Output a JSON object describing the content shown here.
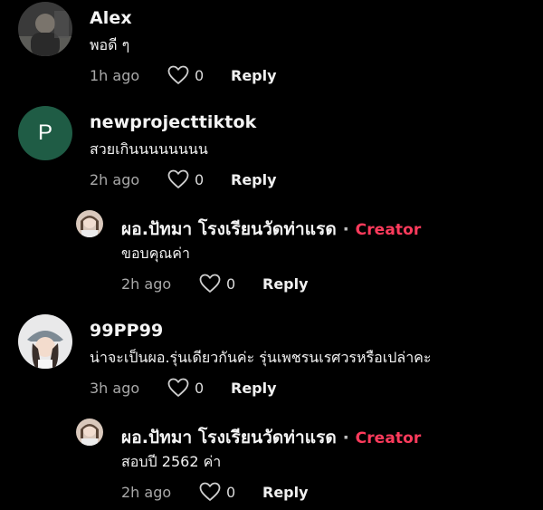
{
  "colors": {
    "background": "#000000",
    "creator_badge": "#ff3b5c",
    "muted_text": "#a9a9a9",
    "avatar_p_bg": "#1f5c45"
  },
  "comments": [
    {
      "username": "Alex",
      "text": "พอดี ๆ",
      "time": "1h ago",
      "likes": "0",
      "reply_label": "Reply",
      "avatar_icon": "user-photo-avatar"
    },
    {
      "username": "newprojecttiktok",
      "text": "สวยเกินนนนนนนน",
      "time": "2h ago",
      "likes": "0",
      "reply_label": "Reply",
      "avatar_letter": "P"
    },
    {
      "username": "ผอ.ปัทมา โรงเรียนวัดท่าแรด",
      "separator": "·",
      "badge": "Creator",
      "text": "ขอบคุณค่า",
      "time": "2h ago",
      "likes": "0",
      "reply_label": "Reply",
      "avatar_icon": "user-photo-avatar"
    },
    {
      "username": "99PP99",
      "text": "น่าจะเป็นผอ.รุ่นเดียวกันค่ะ รุ่นเพชรนเรศวรหรือเปล่าคะ",
      "time": "3h ago",
      "likes": "0",
      "reply_label": "Reply",
      "avatar_icon": "user-photo-avatar"
    },
    {
      "username": "ผอ.ปัทมา โรงเรียนวัดท่าแรด",
      "separator": "·",
      "badge": "Creator",
      "text": "สอบปี 2562 ค่า",
      "time": "2h ago",
      "likes": "0",
      "reply_label": "Reply",
      "avatar_icon": "user-photo-avatar"
    }
  ]
}
